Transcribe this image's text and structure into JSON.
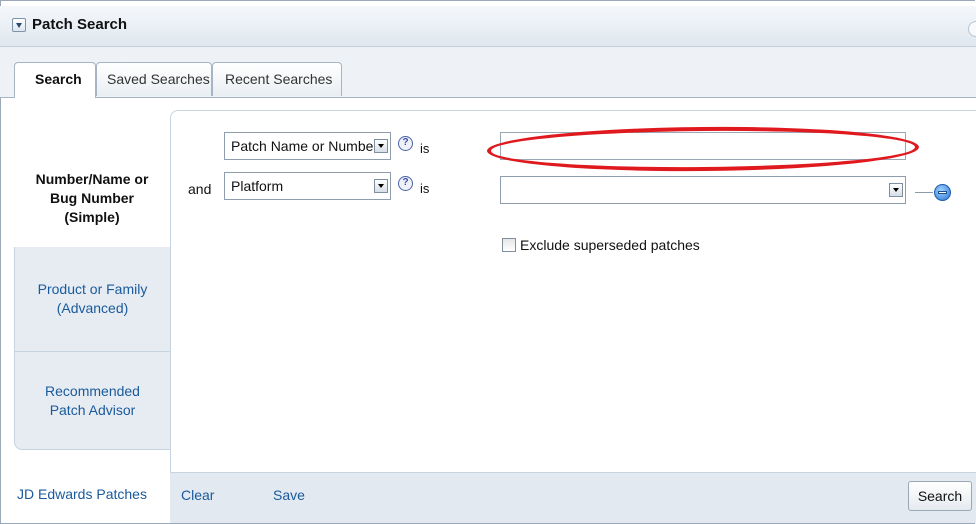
{
  "header": {
    "title": "Patch Search"
  },
  "tabs": [
    {
      "label": "Search",
      "active": true
    },
    {
      "label": "Saved Searches",
      "active": false
    },
    {
      "label": "Recent Searches",
      "active": false
    }
  ],
  "leftnav": {
    "items": [
      {
        "label": "Number/Name or Bug Number (Simple)",
        "active": true
      },
      {
        "label": "Product or Family (Advanced)",
        "active": false
      },
      {
        "label": "Recommended Patch Advisor",
        "active": false
      }
    ],
    "jde_link": "JD Edwards Patches"
  },
  "criteria": {
    "row1": {
      "field": "Patch Name or Number",
      "operator": "is",
      "value": ""
    },
    "row2": {
      "conjunction": "and",
      "field": "Platform",
      "operator": "is",
      "value": ""
    }
  },
  "exclude_superseded": {
    "label": "Exclude superseded patches",
    "checked": false
  },
  "footer": {
    "clear": "Clear",
    "save": "Save",
    "search": "Search"
  },
  "colors": {
    "annotation": "#e0191e",
    "link": "#1a5a9c",
    "tab_bar": "#eef2f6"
  },
  "icons": [
    "collapse-triangle-icon",
    "help-icon",
    "dropdown-arrow-icon",
    "remove-row-icon"
  ]
}
